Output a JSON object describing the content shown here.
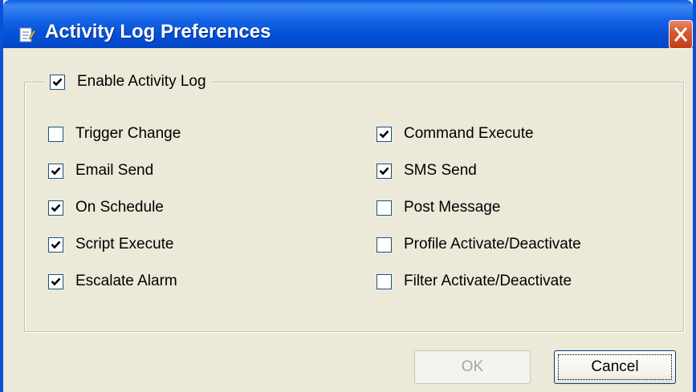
{
  "window": {
    "title": "Activity Log Preferences",
    "title_icon": "document-pencil-icon",
    "close_icon": "close-icon"
  },
  "group": {
    "label": "Enable Activity Log",
    "checked": true
  },
  "left_options": [
    {
      "label": "Trigger Change",
      "checked": false
    },
    {
      "label": "Email Send",
      "checked": true
    },
    {
      "label": "On Schedule",
      "checked": true
    },
    {
      "label": "Script Execute",
      "checked": true
    },
    {
      "label": "Escalate Alarm",
      "checked": true
    }
  ],
  "right_options": [
    {
      "label": "Command Execute",
      "checked": true
    },
    {
      "label": "SMS Send",
      "checked": true
    },
    {
      "label": "Post Message",
      "checked": false
    },
    {
      "label": "Profile Activate/Deactivate",
      "checked": false
    },
    {
      "label": "Filter Activate/Deactivate",
      "checked": false
    }
  ],
  "buttons": {
    "ok_label": "OK",
    "ok_enabled": false,
    "cancel_label": "Cancel"
  },
  "colors": {
    "titlebar": "#0451d8",
    "face": "#ece9d8",
    "close": "#c33e1a"
  }
}
